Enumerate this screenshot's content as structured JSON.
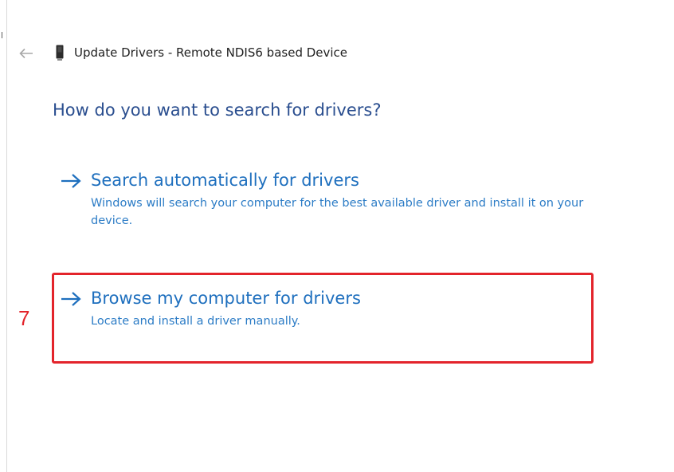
{
  "window": {
    "title": "Update Drivers - Remote NDIS6 based Device",
    "back_icon": "back-arrow-icon",
    "device_icon": "network-device-icon"
  },
  "heading": "How do you want to search for drivers?",
  "options": [
    {
      "label": "Search automatically for drivers",
      "description": "Windows will search your computer for the best available driver and install it on your device.",
      "icon": "arrow-right-icon"
    },
    {
      "label": "Browse my computer for drivers",
      "description": "Locate and install a driver manually.",
      "icon": "arrow-right-icon"
    }
  ],
  "annotation": {
    "step": "7",
    "color": "#e3242b"
  },
  "colors": {
    "link": "#1e6fbe",
    "heading": "#2a4e8f"
  }
}
